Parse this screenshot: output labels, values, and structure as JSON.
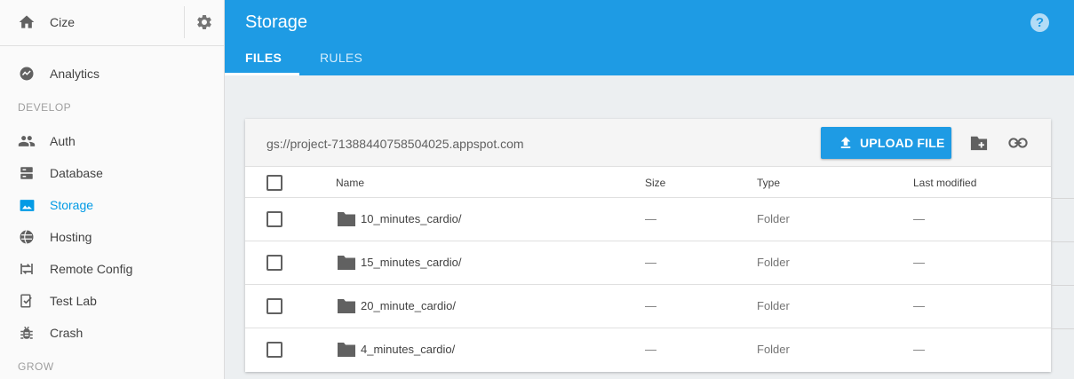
{
  "sidebar": {
    "project_name": "Cize",
    "items_top": [
      {
        "label": "Analytics",
        "icon": "analytics-icon"
      }
    ],
    "develop_label": "DEVELOP",
    "develop_items": [
      {
        "label": "Auth",
        "icon": "people-icon"
      },
      {
        "label": "Database",
        "icon": "database-icon"
      },
      {
        "label": "Storage",
        "icon": "image-icon",
        "active": true
      },
      {
        "label": "Hosting",
        "icon": "globe-icon"
      },
      {
        "label": "Remote Config",
        "icon": "remote-config-icon"
      },
      {
        "label": "Test Lab",
        "icon": "test-lab-icon"
      },
      {
        "label": "Crash",
        "icon": "bug-icon"
      }
    ],
    "grow_label": "GROW"
  },
  "header": {
    "title": "Storage",
    "help": "?",
    "tabs": [
      {
        "label": "FILES",
        "active": true
      },
      {
        "label": "RULES",
        "active": false
      }
    ]
  },
  "storage": {
    "bucket": "gs://project-71388440758504025.appspot.com",
    "upload_label": "UPLOAD FILE",
    "columns": {
      "name": "Name",
      "size": "Size",
      "type": "Type",
      "modified": "Last modified"
    },
    "rows": [
      {
        "name": "10_minutes_cardio/",
        "size": "—",
        "type": "Folder",
        "modified": "—"
      },
      {
        "name": "15_minutes_cardio/",
        "size": "—",
        "type": "Folder",
        "modified": "—"
      },
      {
        "name": "20_minute_cardio/",
        "size": "—",
        "type": "Folder",
        "modified": "—"
      },
      {
        "name": "4_minutes_cardio/",
        "size": "—",
        "type": "Folder",
        "modified": "—"
      }
    ]
  },
  "colors": {
    "accent": "#1e9be4",
    "active_nav": "#039be5",
    "sidebar_bg": "#fafafa",
    "content_bg": "#eceff1"
  }
}
